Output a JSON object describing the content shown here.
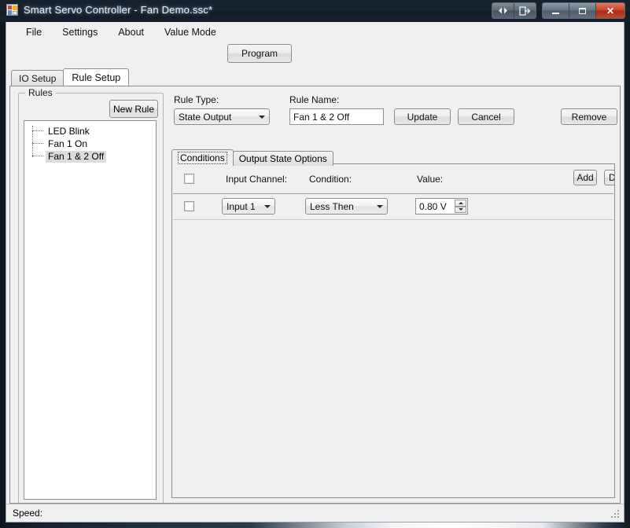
{
  "window": {
    "title": "Smart Servo Controller - Fan Demo.ssc*",
    "icon": "app-window-icon",
    "controls": {
      "prev_next_label": "◀▶",
      "restore_down_label": "↪",
      "minimize_label": "–",
      "maximize_label": "☐",
      "close_label": "✕"
    }
  },
  "menu": {
    "items": [
      {
        "label": "File"
      },
      {
        "label": "Settings"
      },
      {
        "label": "About"
      },
      {
        "label": "Value Mode"
      }
    ]
  },
  "toolbar": {
    "program_label": "Program"
  },
  "tabs": {
    "items": [
      {
        "label": "IO Setup",
        "active": false
      },
      {
        "label": "Rule Setup",
        "active": true
      }
    ]
  },
  "rules_group": {
    "title": "Rules",
    "new_rule_label": "New Rule",
    "tree_items": [
      {
        "label": "LED Blink",
        "selected": false
      },
      {
        "label": "Fan 1 On",
        "selected": false
      },
      {
        "label": "Fan 1 & 2 Off",
        "selected": true
      }
    ]
  },
  "rule_editor": {
    "rule_type_label": "Rule Type:",
    "rule_type_value": "State Output",
    "rule_type_options": [
      "State Output"
    ],
    "rule_name_label": "Rule Name:",
    "rule_name_value": "Fan 1 & 2 Off",
    "rule_name_placeholder": "",
    "update_label": "Update",
    "cancel_label": "Cancel",
    "remove_label": "Remove"
  },
  "inner_tabs": {
    "items": [
      {
        "label": "Conditions",
        "active": true
      },
      {
        "label": "Output State Options",
        "active": false
      }
    ]
  },
  "conditions": {
    "add_label": "Add",
    "del_label": "Del",
    "columns": [
      "",
      "Input Channel:",
      "Condition:",
      "Value:"
    ],
    "rows": [
      {
        "checked": false,
        "input_channel": "Input 1",
        "condition": "Less Then",
        "value": "0.80 V"
      }
    ],
    "header_checkbox_checked": false
  },
  "statusbar": {
    "speed_label": "Speed:"
  }
}
